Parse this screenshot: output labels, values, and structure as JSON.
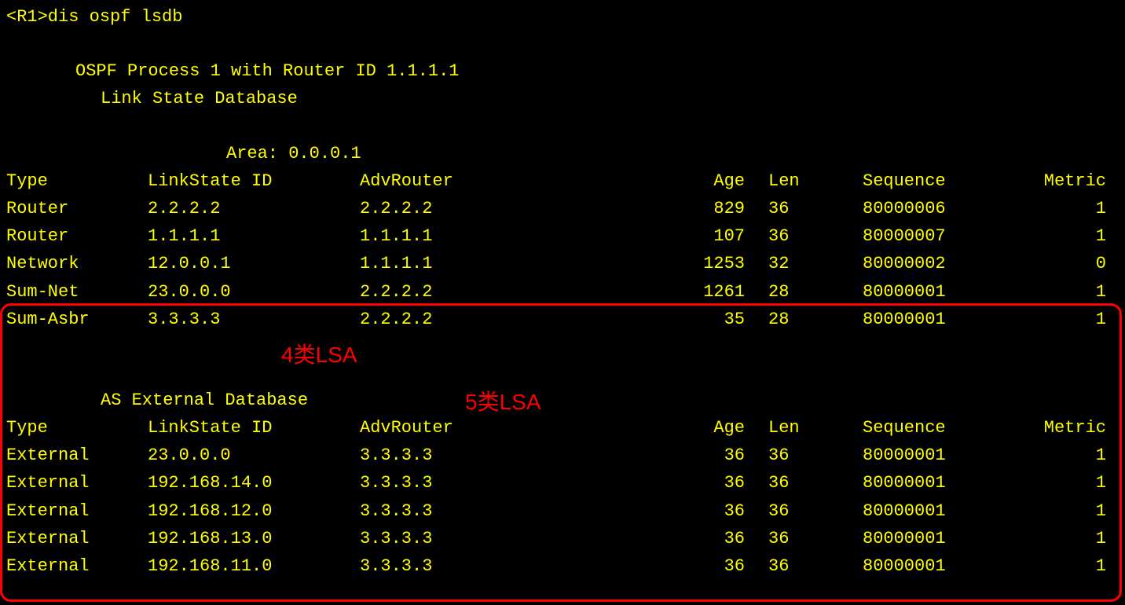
{
  "prompt": "<R1>dis ospf lsdb",
  "process_line": "OSPF Process 1 with Router ID 1.1.1.1",
  "db_title": "Link State Database",
  "area_line": "Area: 0.0.0.1",
  "headers": {
    "type": "Type",
    "linkstate": "LinkState ID",
    "advrouter": "AdvRouter",
    "age": "Age",
    "len": "Len",
    "sequence": "Sequence",
    "metric": "Metric"
  },
  "area_rows": [
    {
      "type": "Router",
      "ls": "2.2.2.2",
      "adv": "2.2.2.2",
      "age": "829",
      "len": "36",
      "seq": "80000006",
      "met": "1"
    },
    {
      "type": "Router",
      "ls": "1.1.1.1",
      "adv": "1.1.1.1",
      "age": "107",
      "len": "36",
      "seq": "80000007",
      "met": "1"
    },
    {
      "type": "Network",
      "ls": "12.0.0.1",
      "adv": "1.1.1.1",
      "age": "1253",
      "len": "32",
      "seq": "80000002",
      "met": "0"
    },
    {
      "type": "Sum-Net",
      "ls": "23.0.0.0",
      "adv": "2.2.2.2",
      "age": "1261",
      "len": "28",
      "seq": "80000001",
      "met": "1"
    },
    {
      "type": "Sum-Asbr",
      "ls": "3.3.3.3",
      "adv": "2.2.2.2",
      "age": "35",
      "len": "28",
      "seq": "80000001",
      "met": "1"
    }
  ],
  "ext_title": "AS External Database",
  "ext_rows": [
    {
      "type": "External",
      "ls": "23.0.0.0",
      "adv": "3.3.3.3",
      "age": "36",
      "len": "36",
      "seq": "80000001",
      "met": "1"
    },
    {
      "type": "External",
      "ls": "192.168.14.0",
      "adv": "3.3.3.3",
      "age": "36",
      "len": "36",
      "seq": "80000001",
      "met": "1"
    },
    {
      "type": "External",
      "ls": "192.168.12.0",
      "adv": "3.3.3.3",
      "age": "36",
      "len": "36",
      "seq": "80000001",
      "met": "1"
    },
    {
      "type": "External",
      "ls": "192.168.13.0",
      "adv": "3.3.3.3",
      "age": "36",
      "len": "36",
      "seq": "80000001",
      "met": "1"
    },
    {
      "type": "External",
      "ls": "192.168.11.0",
      "adv": "3.3.3.3",
      "age": "36",
      "len": "36",
      "seq": "80000001",
      "met": "1"
    }
  ],
  "annotation1": "4类LSA",
  "annotation2": "5类LSA"
}
